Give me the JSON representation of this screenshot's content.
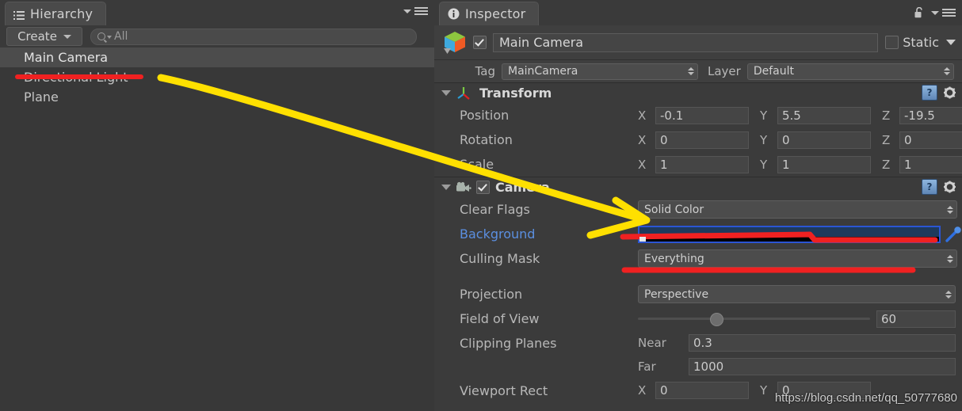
{
  "hierarchy": {
    "tab_label": "Hierarchy",
    "tab_icon": "list-icon",
    "menu_icon": "panel-menu-icon",
    "toolbar": {
      "create_label": "Create",
      "create_caret": "chevron-down-icon",
      "search_placeholder": "All",
      "search_value": "All",
      "search_icon": "search-icon"
    },
    "items": [
      {
        "label": "Main Camera",
        "selected": true
      },
      {
        "label": "Directional Light",
        "selected": false
      },
      {
        "label": "Plane",
        "selected": false
      }
    ]
  },
  "inspector": {
    "tab_label": "Inspector",
    "tab_icon": "info-icon",
    "lock_icon": "lock-open-icon",
    "menu_icon": "panel-menu-icon",
    "object": {
      "prefab_icon": "cube-icon",
      "enabled": true,
      "name": "Main Camera",
      "static_label": "Static",
      "static_checked": false,
      "static_caret": "chevron-down-icon"
    },
    "tag_row": {
      "tag_label": "Tag",
      "tag_value": "MainCamera",
      "layer_label": "Layer",
      "layer_value": "Default"
    },
    "components": [
      {
        "id": "transform",
        "title": "Transform",
        "icon": "transform-gizmo-icon",
        "has_checkbox": false,
        "expanded": true,
        "help_icon": "help-book-icon",
        "settings_icon": "gear-icon",
        "rows": [
          {
            "label": "Position",
            "axes": [
              {
                "axis": "X",
                "value": "-0.1"
              },
              {
                "axis": "Y",
                "value": "5.5"
              },
              {
                "axis": "Z",
                "value": "-19.5"
              }
            ]
          },
          {
            "label": "Rotation",
            "axes": [
              {
                "axis": "X",
                "value": "0"
              },
              {
                "axis": "Y",
                "value": "0"
              },
              {
                "axis": "Z",
                "value": "0"
              }
            ]
          },
          {
            "label": "Scale",
            "axes": [
              {
                "axis": "X",
                "value": "1"
              },
              {
                "axis": "Y",
                "value": "1"
              },
              {
                "axis": "Z",
                "value": "1"
              }
            ]
          }
        ]
      },
      {
        "id": "camera",
        "title": "Camera",
        "icon": "camera-icon",
        "has_checkbox": true,
        "enabled": true,
        "expanded": true,
        "help_icon": "help-book-icon",
        "settings_icon": "gear-icon",
        "clear_flags": {
          "label": "Clear Flags",
          "value": "Solid Color"
        },
        "background": {
          "label": "Background",
          "color": "#1e3a5c",
          "eyedropper_icon": "eyedropper-icon"
        },
        "culling_mask": {
          "label": "Culling Mask",
          "value": "Everything"
        },
        "projection": {
          "label": "Projection",
          "value": "Perspective"
        },
        "field_of_view": {
          "label": "Field of View",
          "value": "60",
          "slider_percent": 31
        },
        "clipping_planes": {
          "label": "Clipping Planes",
          "near_label": "Near",
          "near_value": "0.3",
          "far_label": "Far",
          "far_value": "1000"
        },
        "viewport_rect": {
          "label": "Viewport Rect",
          "axes": [
            {
              "axis": "X",
              "value": "0"
            },
            {
              "axis": "Y",
              "value": "0"
            }
          ]
        }
      }
    ]
  },
  "annotations": {
    "arrow_color": "#FFE000",
    "underline_color": "#F02121",
    "watermark": "https://blog.csdn.net/qq_50777680"
  }
}
